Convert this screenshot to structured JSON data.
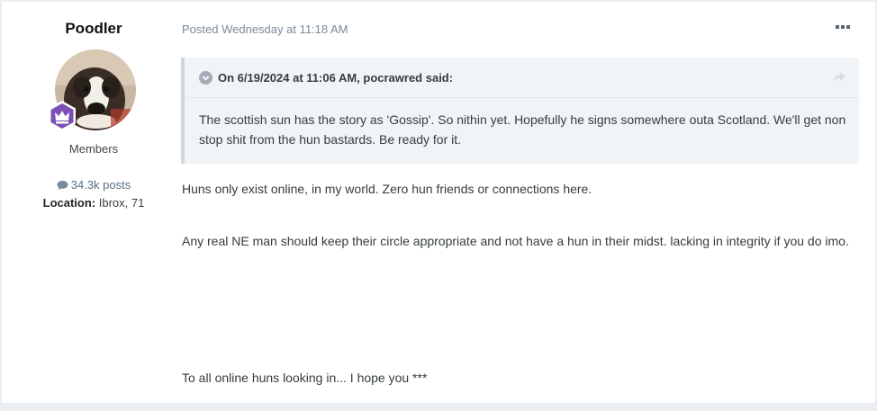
{
  "author": {
    "name": "Poodler",
    "group": "Members",
    "posts": "34.3k posts",
    "location_label": "Location:",
    "location_value": "Ibrox, 71"
  },
  "post": {
    "meta": "Posted Wednesday at 11:18 AM",
    "quote": {
      "header": "On 6/19/2024 at 11:06 AM, pocrawred said:",
      "body": "The scottish sun has the story as 'Gossip'. So nithin yet. Hopefully he signs somewhere outa Scotland. We'll get non stop shit from the hun bastards. Be ready for it."
    },
    "paragraphs": [
      "Huns only exist online, in my world. Zero hun friends or connections here.",
      "Any real NE man should keep their circle appropriate and not have a hun in their midst. lacking in integrity if you do imo.",
      "To all online huns looking in... I hope you ***"
    ]
  },
  "icons": {
    "more": "ellipsis-icon",
    "collapse": "chevron-down-circle-icon",
    "share": "share-arrow-icon",
    "posts": "comment-icon",
    "rank": "crown-badge-icon"
  },
  "colors": {
    "background": "#ebeef2",
    "quote_bg": "#f1f4f7",
    "meta": "#7b8a99",
    "badge": "#7a4fb6"
  }
}
